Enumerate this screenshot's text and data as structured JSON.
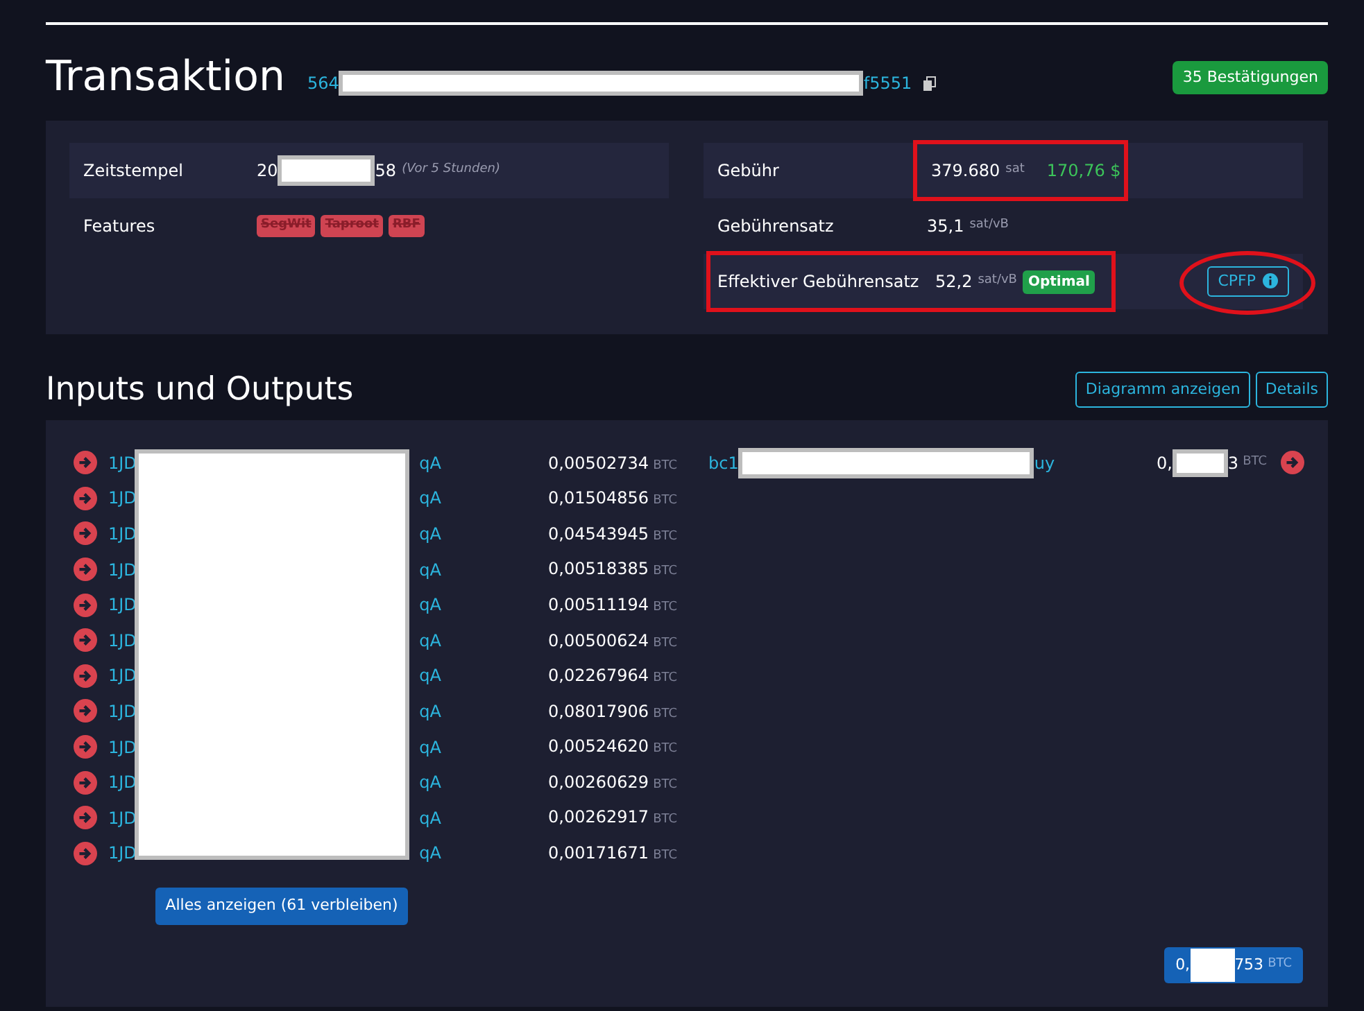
{
  "transaction": {
    "title": "Transaktion",
    "txid_start": "564",
    "txid_end": "f5551",
    "confirmations": "35 Bestätigungen"
  },
  "details_left": [
    {
      "kind": "timestamp",
      "label": "Zeitstempel",
      "value_start": "20",
      "value_end": "58",
      "note": "(Vor 5 Stunden)"
    },
    {
      "kind": "tags",
      "label": "Features",
      "tags": [
        "SegWit",
        "Taproot",
        "RBF"
      ]
    }
  ],
  "details_right": [
    {
      "label": "Gebühr",
      "value": "379.680",
      "unit": "sat",
      "fiat": "170,76 $",
      "annotated": true
    },
    {
      "label": "Gebührensatz",
      "value": "35,1",
      "unit": "sat/vB",
      "annotated": false
    },
    {
      "label": "Effektiver Gebührensatz",
      "value": "52,2",
      "unit": "sat/vB",
      "badge": "Optimal",
      "annotated": true,
      "button": "CPFP"
    }
  ],
  "io": {
    "title": "Inputs und Outputs",
    "buttons": [
      "Diagramm anzeigen",
      "Details"
    ],
    "inputs": [
      {
        "address_start": "1JD",
        "address_end": "qA",
        "amount": "0,00502734",
        "unit": "BTC"
      },
      {
        "address_start": "1JD",
        "address_end": "qA",
        "amount": "0,01504856",
        "unit": "BTC"
      },
      {
        "address_start": "1JD",
        "address_end": "qA",
        "amount": "0,04543945",
        "unit": "BTC"
      },
      {
        "address_start": "1JD",
        "address_end": "qA",
        "amount": "0,00518385",
        "unit": "BTC"
      },
      {
        "address_start": "1JD",
        "address_end": "qA",
        "amount": "0,00511194",
        "unit": "BTC"
      },
      {
        "address_start": "1JD",
        "address_end": "qA",
        "amount": "0,00500624",
        "unit": "BTC"
      },
      {
        "address_start": "1JD",
        "address_end": "qA",
        "amount": "0,02267964",
        "unit": "BTC"
      },
      {
        "address_start": "1JD",
        "address_end": "qA",
        "amount": "0,08017906",
        "unit": "BTC"
      },
      {
        "address_start": "1JD",
        "address_end": "qA",
        "amount": "0,00524620",
        "unit": "BTC"
      },
      {
        "address_start": "1JD",
        "address_end": "qA",
        "amount": "0,00260629",
        "unit": "BTC"
      },
      {
        "address_start": "1JD",
        "address_end": "qA",
        "amount": "0,00262917",
        "unit": "BTC"
      },
      {
        "address_start": "1JD",
        "address_end": "qA",
        "amount": "0,00171671",
        "unit": "BTC"
      }
    ],
    "show_all": "Alles anzeigen (61 verbleiben)",
    "outputs": [
      {
        "address_start": "bc1",
        "address_end": "uy",
        "amount_start": "0,",
        "amount_end": "3",
        "unit": "BTC"
      }
    ],
    "total": {
      "amount_start": "0,",
      "amount_end": "753",
      "unit": "BTC"
    }
  }
}
